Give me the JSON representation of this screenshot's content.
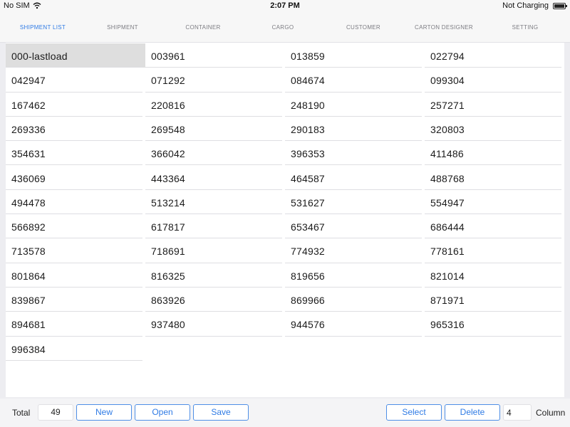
{
  "status_bar": {
    "carrier": "No SIM",
    "time": "2:07 PM",
    "battery_text": "Not Charging",
    "icons": [
      "wifi-icon",
      "battery-icon"
    ]
  },
  "tabs": [
    {
      "label": "SHIPMENT LIST",
      "active": true
    },
    {
      "label": "SHIPMENT",
      "active": false
    },
    {
      "label": "CONTAINER",
      "active": false
    },
    {
      "label": "CARGO",
      "active": false
    },
    {
      "label": "CUSTOMER",
      "active": false
    },
    {
      "label": "CARTON DESIGNER",
      "active": false
    },
    {
      "label": "SETTING",
      "active": false
    }
  ],
  "shipments": [
    "000-lastload",
    "003961",
    "013859",
    "022794",
    "042947",
    "071292",
    "084674",
    "099304",
    "167462",
    "220816",
    "248190",
    "257271",
    "269336",
    "269548",
    "290183",
    "320803",
    "354631",
    "366042",
    "396353",
    "411486",
    "436069",
    "443364",
    "464587",
    "488768",
    "494478",
    "513214",
    "531627",
    "554947",
    "566892",
    "617817",
    "653467",
    "686444",
    "713578",
    "718691",
    "774932",
    "778161",
    "801864",
    "816325",
    "819656",
    "821014",
    "839867",
    "863926",
    "869966",
    "871971",
    "894681",
    "937480",
    "944576",
    "965316",
    "996384"
  ],
  "selected_shipment": "000-lastload",
  "toolbar": {
    "total_label": "Total",
    "total_value": "49",
    "new_label": "New",
    "open_label": "Open",
    "save_label": "Save",
    "select_label": "Select",
    "delete_label": "Delete",
    "column_value": "4",
    "column_label": "Column"
  },
  "colors": {
    "accent": "#2f7be5",
    "selected_row": "#dedede",
    "background": "#ededf1"
  }
}
